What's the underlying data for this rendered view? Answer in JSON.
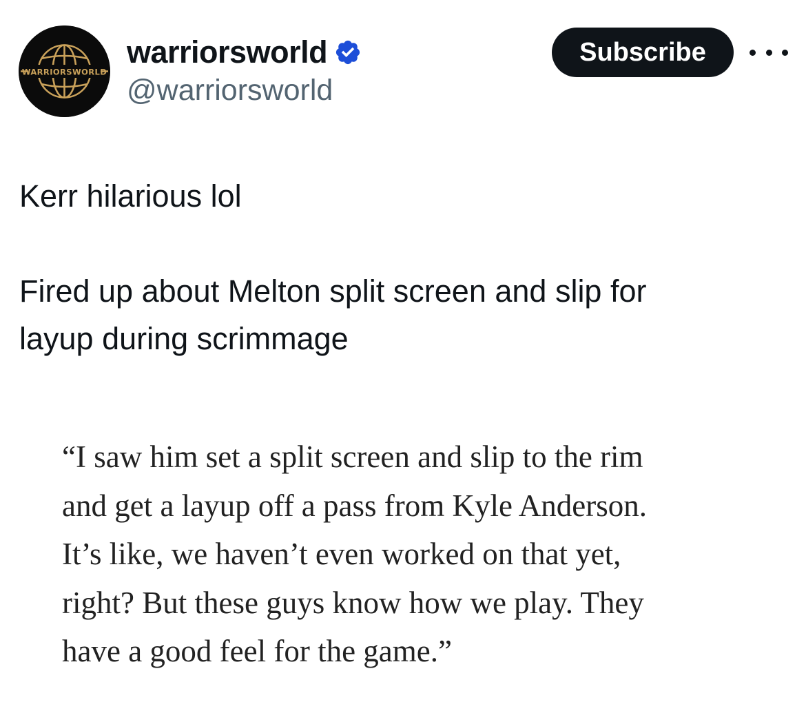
{
  "author": {
    "avatar_text": "WARRIORSWORLD",
    "display_name": "warriorsworld",
    "handle": "@warriorsworld",
    "verified": true,
    "verified_color": "#1d4ed8"
  },
  "actions": {
    "subscribe_label": "Subscribe",
    "more_icon": "more-horizontal-icon"
  },
  "tweet": {
    "line1": "Kerr hilarious lol",
    "line2a": "Fired up about Melton split screen and slip for",
    "line2b": "layup during scrimmage"
  },
  "quote": {
    "lines": [
      "“I saw him set a split screen and slip to the rim",
      "and get a layup off a pass from Kyle Anderson.",
      "It’s like, we haven’t even worked on that yet,",
      "right? But these guys know how we play. They",
      "have a good feel for the game.”"
    ]
  },
  "colors": {
    "text": "#0f1419",
    "secondary": "#536471",
    "button_bg": "#0f1419",
    "logo_gold": "#c9a15a"
  }
}
